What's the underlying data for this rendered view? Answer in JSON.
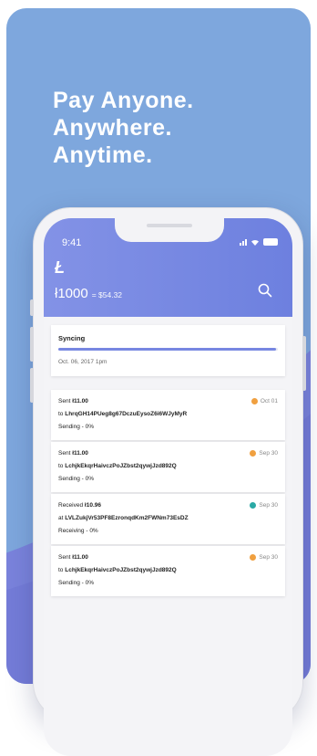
{
  "headline": [
    "Pay Anyone.",
    "Anywhere.",
    "Anytime."
  ],
  "status": {
    "time": "9:41"
  },
  "wallet": {
    "logo": "Ł",
    "balance": "ł1000",
    "fiat": "= $54.32"
  },
  "sync": {
    "title": "Syncing",
    "progress": 0.99,
    "date": "Oct. 06, 2017 1pm"
  },
  "transactions": [
    {
      "type": "Sent",
      "amount": "ł11.00",
      "prep": "to",
      "address": "LhrqGH14PUeg8g67DczuEysoZ6i6WJyMyR",
      "status": "Sending - 0%",
      "date": "Oct 01",
      "color": "#f0a040"
    },
    {
      "type": "Sent",
      "amount": "ł11.00",
      "prep": "to",
      "address": "LchjkEkqrHaivczPoJZbst2qywjJzd892Q",
      "status": "Sending - 0%",
      "date": "Sep 30",
      "color": "#f0a040"
    },
    {
      "type": "Received",
      "amount": "ł10.96",
      "prep": "at",
      "address": "LVLZukjVr53PF8EzronqdKm2FWNm73EsDZ",
      "status": "Receiving - 0%",
      "date": "Sep 30",
      "color": "#2aa9a5"
    },
    {
      "type": "Sent",
      "amount": "ł11.00",
      "prep": "to",
      "address": "LchjkEkqrHaivczPoJZbst2qywjJzd892Q",
      "status": "Sending - 0%",
      "date": "Sep 30",
      "color": "#f0a040"
    }
  ],
  "colors": {
    "background": "#7ea7dd",
    "wave": "#7a83dc",
    "header": "#7787e1"
  },
  "icons": [
    "search-icon",
    "signal-icon",
    "wifi-icon",
    "battery-icon",
    "litecoin-logo-icon"
  ]
}
